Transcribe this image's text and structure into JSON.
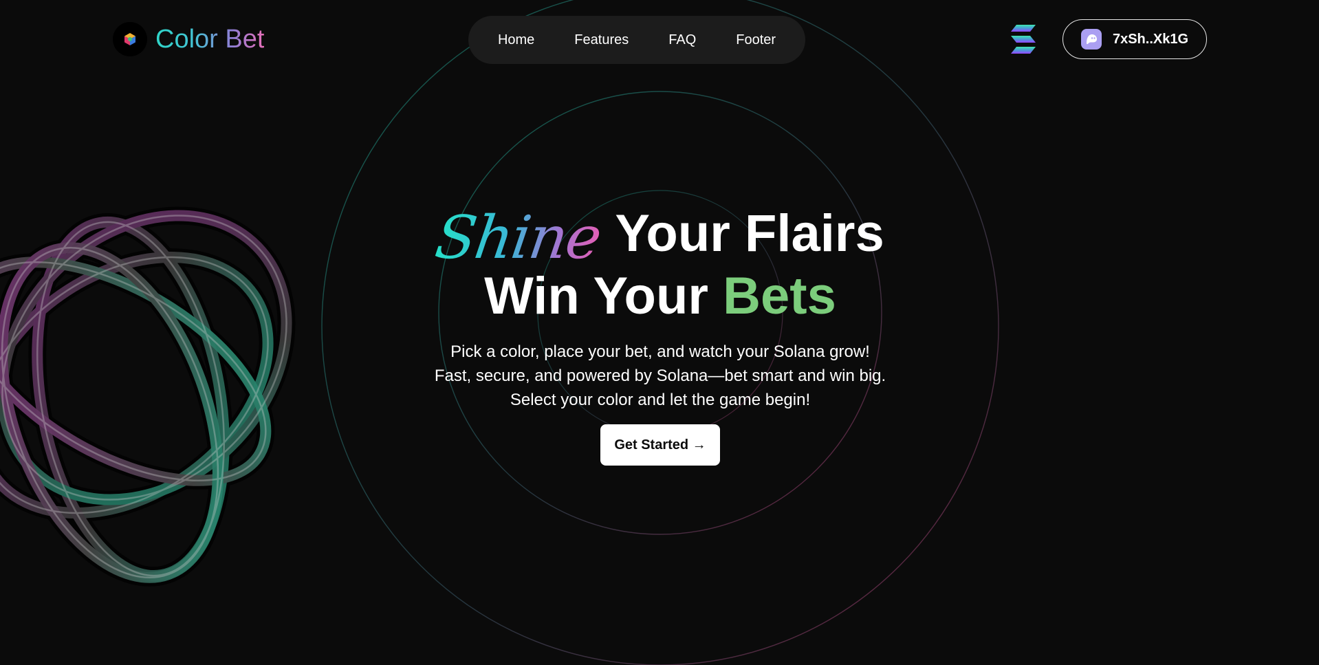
{
  "brand": {
    "name": "Color Bet",
    "logo_icon": "color-cube-icon"
  },
  "nav": {
    "items": [
      {
        "label": "Home"
      },
      {
        "label": "Features"
      },
      {
        "label": "FAQ"
      },
      {
        "label": "Footer"
      }
    ]
  },
  "header": {
    "chain_icon": "solana-logo-icon",
    "wallet": {
      "icon": "phantom-ghost-icon",
      "address": "7xSh..Xk1G"
    }
  },
  "hero": {
    "script_word": "Shine",
    "headline_line1": "Your Flairs",
    "headline_line2_prefix": "Win Your",
    "headline_line2_accent": "Bets",
    "tagline": [
      "Pick a color, place your bet, and watch your Solana grow!",
      "Fast, secure, and powered by Solana—bet smart and win big.",
      "Select your color and let the game begin!"
    ],
    "cta_label": "Get Started →"
  },
  "colors": {
    "background": "#0b0b0b",
    "nav_background": "#1c1c1c",
    "accent_green": "#7ccd7c",
    "gradient_teal": "#2fd6c8",
    "gradient_pink": "#e46fb8",
    "wallet_icon_bg": "#ab9ff2"
  }
}
